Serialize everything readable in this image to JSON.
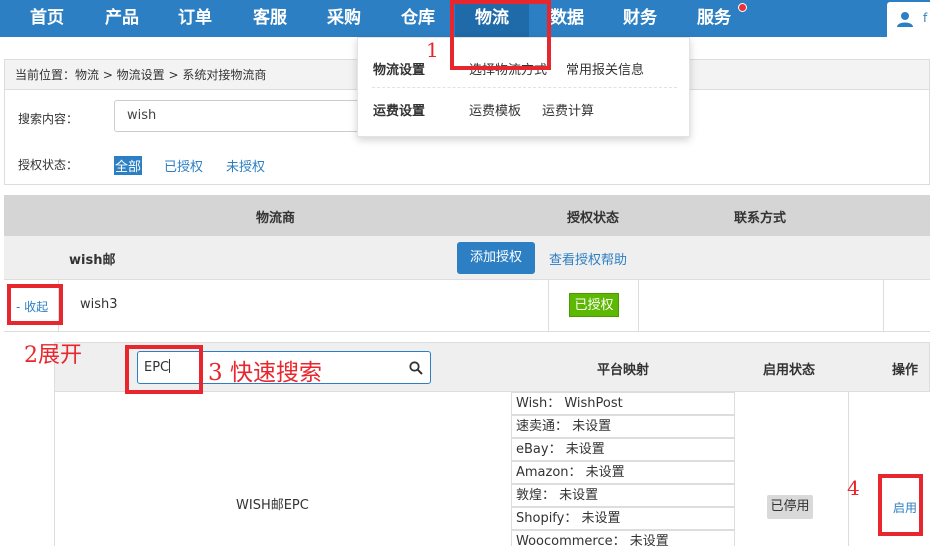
{
  "topnav": {
    "items": [
      "首页",
      "产品",
      "订单",
      "客服",
      "采购",
      "仓库",
      "物流",
      "数据",
      "财务",
      "服务"
    ],
    "active": "物流",
    "user_text": "f",
    "accent": "#2d7fc3",
    "notify_color": "#e8313a"
  },
  "breadcrumb": "当前位置：物流 > 物流设置 > 系统对接物流商",
  "search": {
    "label": "搜索内容：",
    "value": "wish"
  },
  "auth_filter": {
    "label": "授权状态：",
    "options": [
      "全部",
      "已授权",
      "未授权"
    ],
    "selected": "全部"
  },
  "dropdown": {
    "sections": [
      {
        "title": "物流设置",
        "links": [
          "选择物流方式",
          "常用报关信息"
        ]
      },
      {
        "title": "运费设置",
        "links": [
          "运费模板",
          "运费计算"
        ]
      }
    ]
  },
  "table": {
    "headers": [
      "物流商",
      "授权状态",
      "联系方式"
    ],
    "group": {
      "name": "wish邮",
      "add_button": "添加授权",
      "help_link": "查看授权帮助"
    },
    "row": {
      "toggle": "- 收起",
      "name": "wish3",
      "status": "已授权"
    }
  },
  "subtable": {
    "search_value": "EPC",
    "headers": [
      "平台映射",
      "启用状态",
      "操作"
    ],
    "carrier": "WISH邮EPC",
    "mappings": [
      "Wish： WishPost",
      "速卖通： 未设置",
      "eBay： 未设置",
      "Amazon： 未设置",
      "敦煌： 未设置",
      "Shopify： 未设置",
      "Woocommerce： 未设置"
    ],
    "status": "已停用",
    "action": "启用"
  },
  "annotations": {
    "a1": "1",
    "a2": "2展开",
    "a3": "3 快速搜索",
    "a4": "4",
    "color": "#e8262e"
  }
}
